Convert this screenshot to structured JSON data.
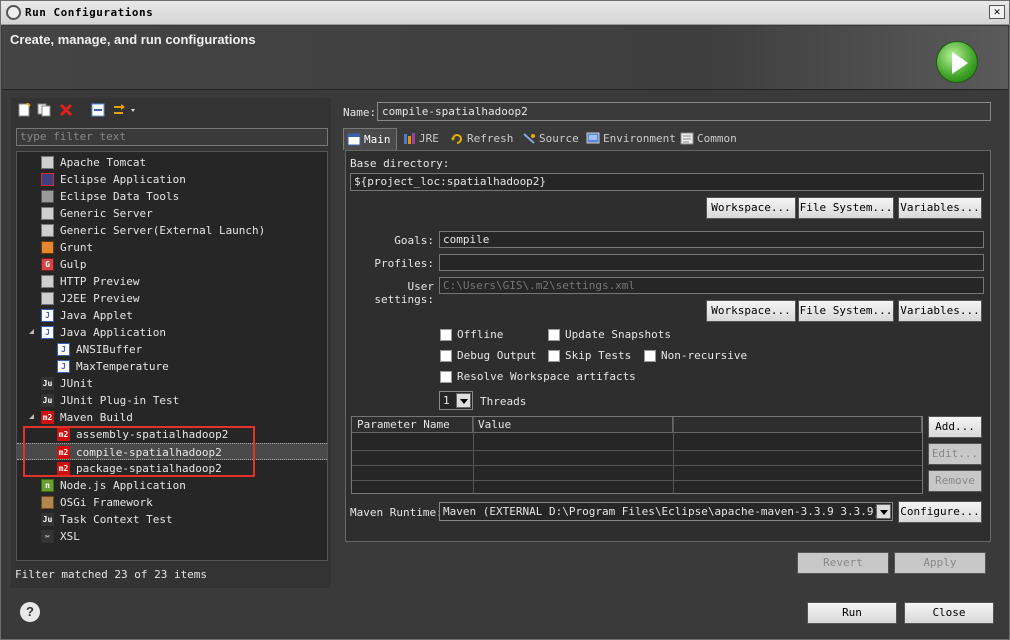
{
  "window": {
    "title": "Run Configurations",
    "close_symbol": "✕"
  },
  "header": {
    "title": "Create, manage, and run configurations"
  },
  "left": {
    "filter_placeholder": "type filter text",
    "tree": [
      {
        "label": "Apache Tomcat",
        "icon": "server-icon",
        "level": 1
      },
      {
        "label": "Eclipse Application",
        "icon": "eclipse-app-icon",
        "level": 1
      },
      {
        "label": "Eclipse Data Tools",
        "icon": "database-icon",
        "level": 1
      },
      {
        "label": "Generic Server",
        "icon": "server-icon",
        "level": 1
      },
      {
        "label": "Generic Server(External Launch)",
        "icon": "server-icon",
        "level": 1
      },
      {
        "label": "Grunt",
        "icon": "grunt-icon",
        "level": 1
      },
      {
        "label": "Gulp",
        "icon": "gulp-icon",
        "level": 1
      },
      {
        "label": "HTTP Preview",
        "icon": "server-icon",
        "level": 1
      },
      {
        "label": "J2EE Preview",
        "icon": "server-icon",
        "level": 1
      },
      {
        "label": "Java Applet",
        "icon": "java-applet-icon",
        "level": 1
      },
      {
        "label": "Java Application",
        "icon": "java-app-icon",
        "level": 1,
        "expanded": true
      },
      {
        "label": "ANSIBuffer",
        "icon": "java-app-icon",
        "level": 2
      },
      {
        "label": "MaxTemperature",
        "icon": "java-app-icon",
        "level": 2
      },
      {
        "label": "JUnit",
        "icon": "junit-icon",
        "level": 1
      },
      {
        "label": "JUnit Plug-in Test",
        "icon": "junit-plugin-icon",
        "level": 1
      },
      {
        "label": "Maven Build",
        "icon": "maven-icon",
        "level": 1,
        "expanded": true
      },
      {
        "label": "assembly-spatialhadoop2",
        "icon": "maven-icon",
        "level": 2
      },
      {
        "label": "compile-spatialhadoop2",
        "icon": "maven-icon",
        "level": 2,
        "selected": true
      },
      {
        "label": "package-spatialhadoop2",
        "icon": "maven-icon",
        "level": 2
      },
      {
        "label": "Node.js Application",
        "icon": "nodejs-icon",
        "level": 1
      },
      {
        "label": "OSGi Framework",
        "icon": "osgi-icon",
        "level": 1
      },
      {
        "label": "Task Context Test",
        "icon": "task-test-icon",
        "level": 1
      },
      {
        "label": "XSL",
        "icon": "xsl-icon",
        "level": 1
      }
    ],
    "status": "Filter matched 23 of 23 items"
  },
  "right": {
    "name_label": "Name:",
    "name_value": "compile-spatialhadoop2",
    "tabs": [
      {
        "label": "Main",
        "icon": "main-tab-icon",
        "active": true
      },
      {
        "label": "JRE",
        "icon": "jre-icon"
      },
      {
        "label": "Refresh",
        "icon": "refresh-icon"
      },
      {
        "label": "Source",
        "icon": "source-icon"
      },
      {
        "label": "Environment",
        "icon": "environment-icon"
      },
      {
        "label": "Common",
        "icon": "common-icon"
      }
    ],
    "base_dir_label": "Base directory:",
    "base_dir_value": "${project_loc:spatialhadoop2}",
    "workspace_btn": "Workspace...",
    "filesystem_btn": "File System...",
    "variables_btn": "Variables...",
    "goals_label": "Goals:",
    "goals_value": "compile",
    "profiles_label": "Profiles:",
    "profiles_value": "",
    "user_settings_label": "User settings:",
    "user_settings_value": "C:\\Users\\GIS\\.m2\\settings.xml",
    "options": {
      "offline": "Offline",
      "update_snapshots": "Update Snapshots",
      "debug_output": "Debug Output",
      "skip_tests": "Skip Tests",
      "non_recursive": "Non-recursive",
      "resolve_workspace": "Resolve Workspace artifacts"
    },
    "threads_value": "1",
    "threads_label": "Threads",
    "table_headers": [
      "Parameter Name",
      "Value"
    ],
    "add_btn": "Add...",
    "edit_btn": "Edit...",
    "remove_btn": "Remove",
    "runtime_label": "Maven Runtime:",
    "runtime_value": "Maven (EXTERNAL D:\\Program Files\\Eclipse\\apache-maven-3.3.9 3.3.9)",
    "configure_btn": "Configure...",
    "revert_btn": "Revert",
    "apply_btn": "Apply"
  },
  "footer": {
    "help": "?",
    "run_btn": "Run",
    "close_btn": "Close"
  },
  "colors": {
    "highlight_box": "#e0332a",
    "run_icon": "#3ea125"
  }
}
